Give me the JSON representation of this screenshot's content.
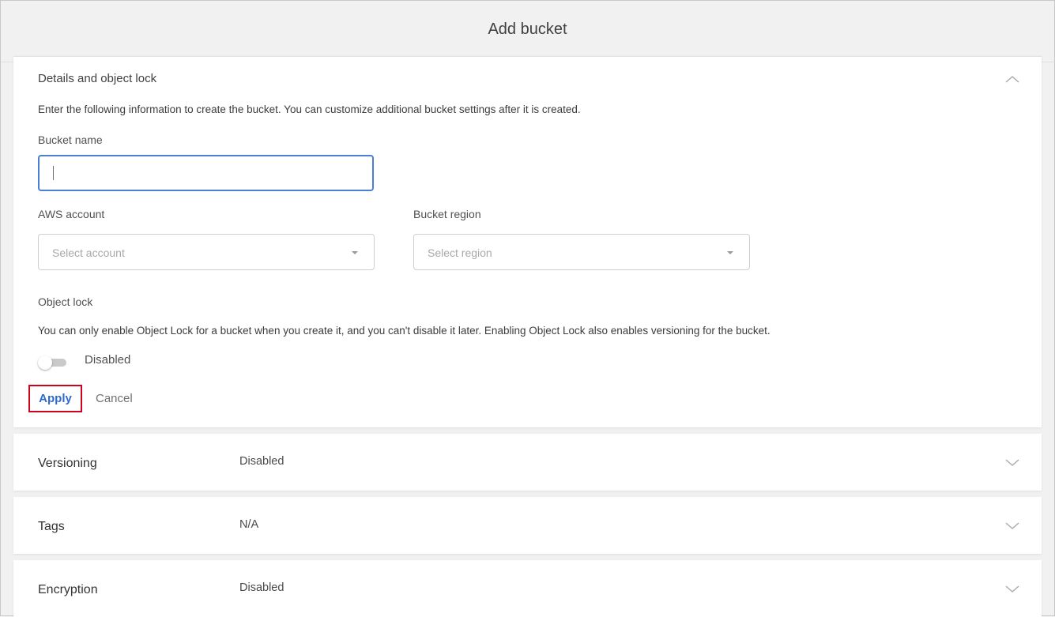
{
  "header": {
    "title": "Add bucket"
  },
  "details": {
    "title": "Details and object lock",
    "intro": "Enter the following information to create the bucket. You can customize additional bucket settings after it is created.",
    "bucket_name": {
      "label": "Bucket name",
      "value": ""
    },
    "aws_account": {
      "label": "AWS account",
      "placeholder": "Select account"
    },
    "bucket_region": {
      "label": "Bucket region",
      "placeholder": "Select region"
    },
    "object_lock": {
      "label": "Object lock",
      "description": "You can only enable Object Lock for a bucket when you create it, and you can't disable it later. Enabling Object Lock also enables versioning for the bucket.",
      "toggle_state": "Disabled"
    },
    "apply_label": "Apply",
    "cancel_label": "Cancel"
  },
  "sections": [
    {
      "label": "Versioning",
      "value": "Disabled"
    },
    {
      "label": "Tags",
      "value": "N/A"
    },
    {
      "label": "Encryption",
      "value": "Disabled"
    }
  ],
  "colors": {
    "focus_border": "#4a7fd4",
    "apply_text": "#2f6bc9",
    "highlight_box": "#d0021b"
  },
  "icons": {
    "expanded": "chevron-up-icon",
    "collapsed": "chevron-down-icon",
    "dropdown": "caret-down-icon"
  }
}
